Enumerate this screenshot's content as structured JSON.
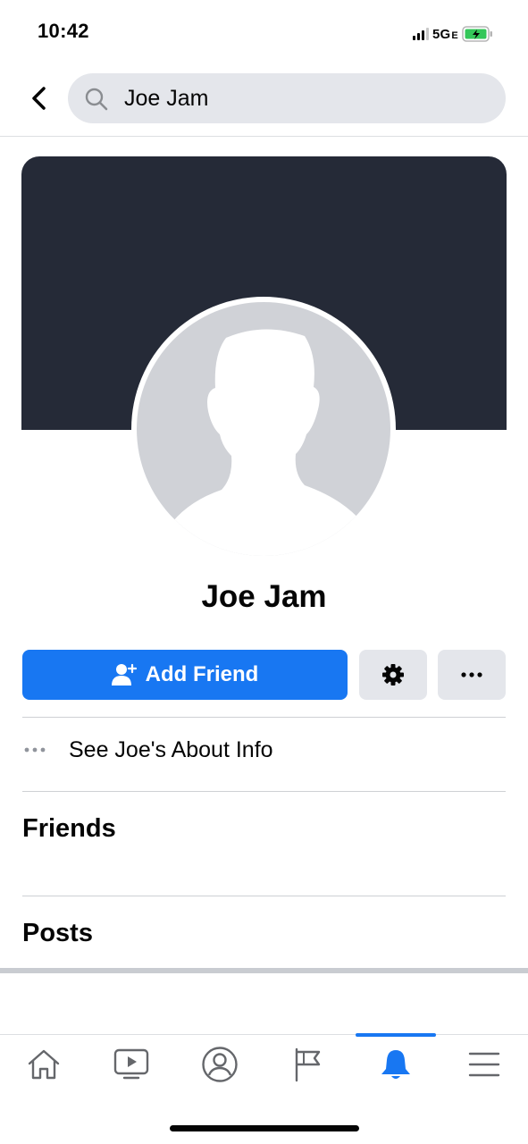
{
  "status_bar": {
    "time": "10:42",
    "network": "5G",
    "network_suffix": "E"
  },
  "search": {
    "query": "Joe Jam"
  },
  "profile": {
    "name": "Joe Jam"
  },
  "actions": {
    "add_friend_label": "Add Friend"
  },
  "about": {
    "label": "See Joe's About Info"
  },
  "sections": {
    "friends": "Friends",
    "posts": "Posts"
  },
  "tabs": [
    {
      "icon": "home-icon",
      "active": false
    },
    {
      "icon": "video-icon",
      "active": false
    },
    {
      "icon": "profile-icon",
      "active": false
    },
    {
      "icon": "pages-flag-icon",
      "active": false
    },
    {
      "icon": "notifications-bell-icon",
      "active": true
    },
    {
      "icon": "menu-icon",
      "active": false
    }
  ],
  "colors": {
    "accent": "#1877f2",
    "cover": "#252a37",
    "button_gray": "#e4e6eb"
  }
}
